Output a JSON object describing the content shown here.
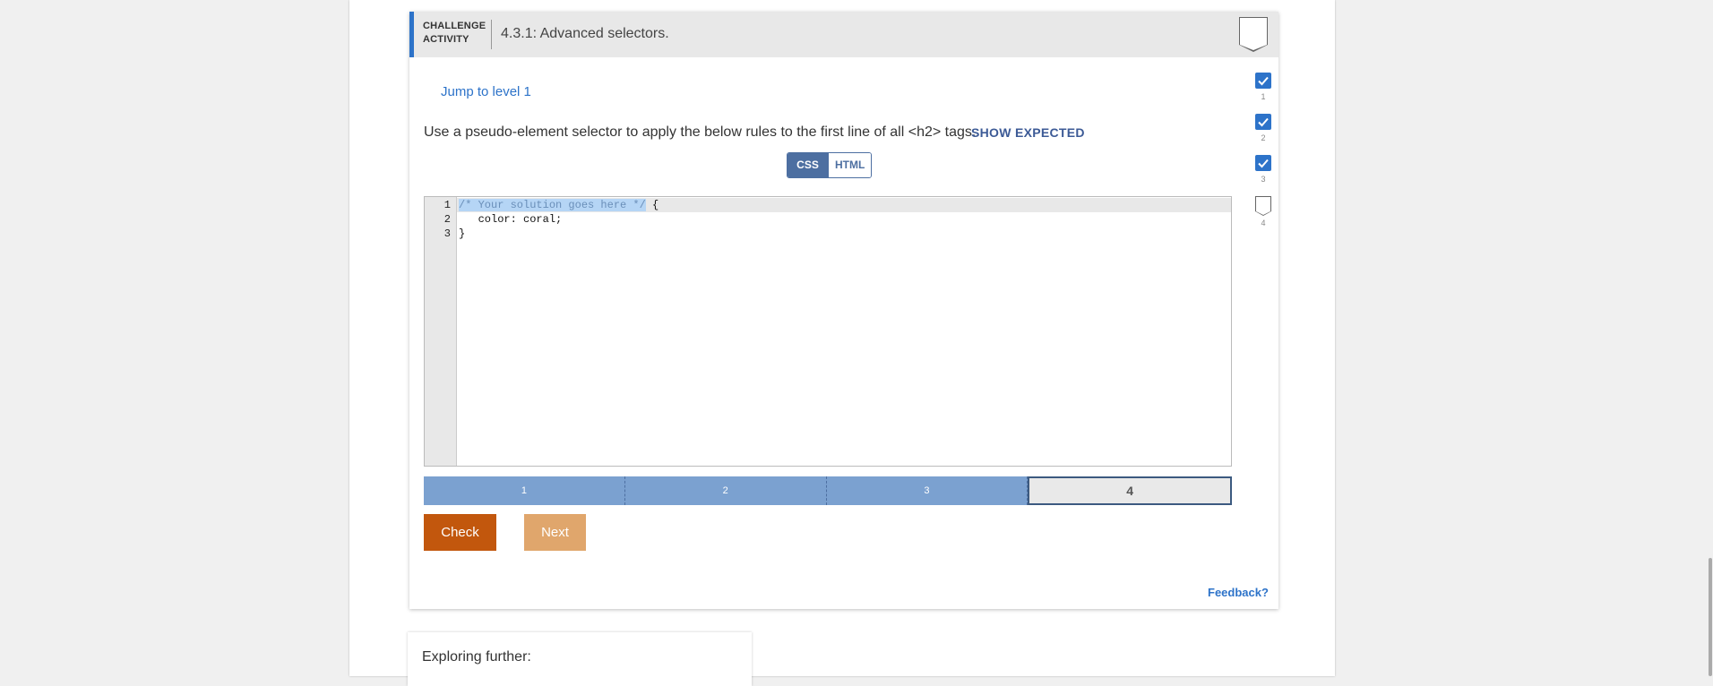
{
  "header": {
    "label_line1": "CHALLENGE",
    "label_line2": "ACTIVITY",
    "title": "4.3.1: Advanced selectors."
  },
  "jump_link": "Jump to level 1",
  "instructions": "Use a pseudo-element selector to apply the below rules to the first line of all <h2> tags.",
  "show_expected": "SHOW EXPECTED",
  "tabs": [
    {
      "label": "CSS",
      "active": true
    },
    {
      "label": "HTML",
      "active": false
    }
  ],
  "editor": {
    "line_numbers": [
      "1",
      "2",
      "3"
    ],
    "lines": {
      "l1_selected": "/* Your solution goes here */",
      "l1_rest": " {",
      "l2": "   color: coral;",
      "l3": "}"
    }
  },
  "levels": [
    {
      "label": "1",
      "completed": true
    },
    {
      "label": "2",
      "completed": true
    },
    {
      "label": "3",
      "completed": true
    },
    {
      "label": "4",
      "completed": false,
      "current": true
    }
  ],
  "side_progress": [
    {
      "label": "1",
      "checked": true
    },
    {
      "label": "2",
      "checked": true
    },
    {
      "label": "3",
      "checked": true
    },
    {
      "label": "4",
      "checked": false
    }
  ],
  "buttons": {
    "check": "Check",
    "next": "Next"
  },
  "feedback": "Feedback?",
  "exploring": "Exploring further:",
  "colors": {
    "accent": "#2d73c9",
    "check_button": "#c2570d",
    "next_button": "#e0a66c",
    "level_done": "#7ba1d0"
  }
}
